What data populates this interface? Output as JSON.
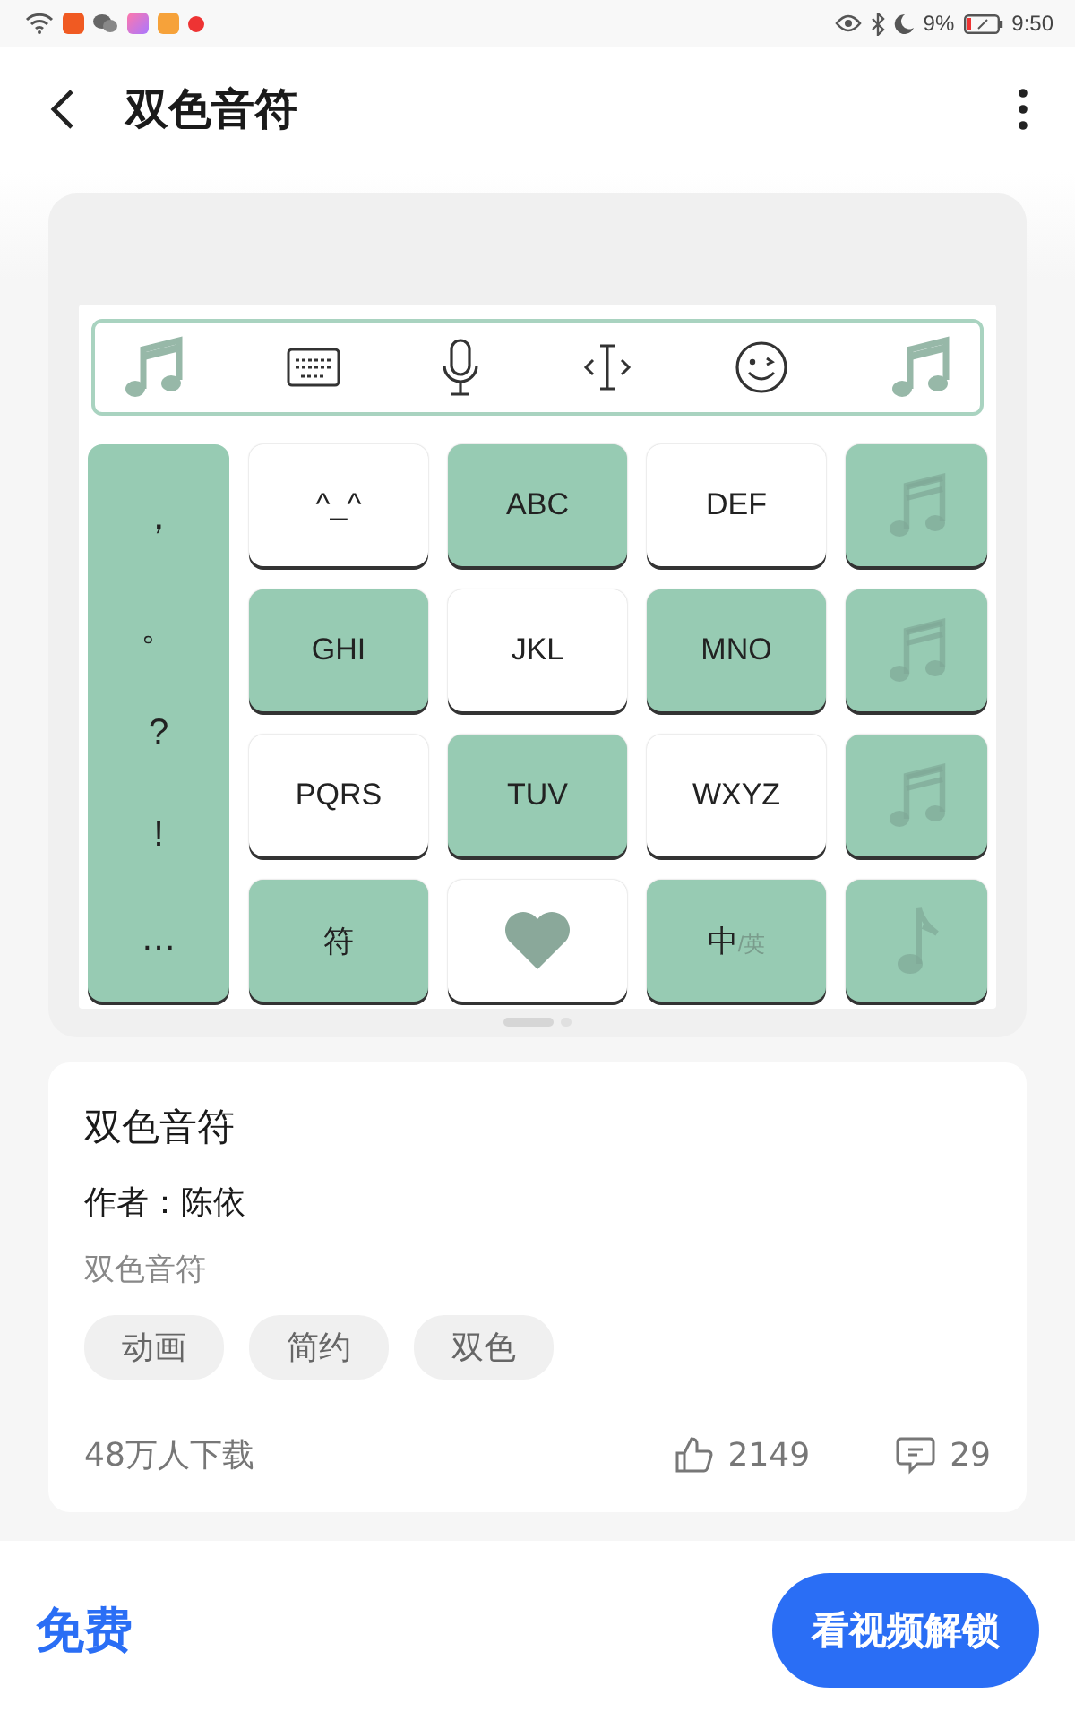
{
  "status_bar": {
    "battery": "9%",
    "time": "9:50"
  },
  "header": {
    "title": "双色音符"
  },
  "preview": {
    "toolbar": [
      {
        "kind": "note"
      },
      {
        "kind": "keyboard"
      },
      {
        "kind": "mic"
      },
      {
        "kind": "cursor"
      },
      {
        "kind": "emoji"
      },
      {
        "kind": "note"
      }
    ],
    "punctuation": [
      "，",
      "。",
      "?",
      "!",
      "…"
    ],
    "keys": [
      {
        "kind": "text",
        "label": "^_^",
        "color": "#ffffff"
      },
      {
        "kind": "text",
        "label": "ABC",
        "color": "#97cbb3"
      },
      {
        "kind": "text",
        "label": "DEF",
        "color": "#ffffff"
      },
      {
        "kind": "text",
        "label": "GHI",
        "color": "#97cbb3"
      },
      {
        "kind": "text",
        "label": "JKL",
        "color": "#ffffff"
      },
      {
        "kind": "text",
        "label": "MNO",
        "color": "#97cbb3"
      },
      {
        "kind": "text",
        "label": "PQRS",
        "color": "#ffffff"
      },
      {
        "kind": "text",
        "label": "TUV",
        "color": "#97cbb3"
      },
      {
        "kind": "text",
        "label": "WXYZ",
        "color": "#ffffff"
      },
      {
        "kind": "text",
        "label": "符",
        "color": "#97cbb3"
      },
      {
        "kind": "heart",
        "color": "#ffffff"
      },
      {
        "kind": "lang",
        "label": "中",
        "sub": "/英",
        "color": "#97cbb3"
      }
    ],
    "side_keys": [
      {
        "kind": "double-note"
      },
      {
        "kind": "double-note"
      },
      {
        "kind": "double-note"
      },
      {
        "kind": "note"
      }
    ],
    "pages": [
      {
        "selected": true
      },
      {
        "selected": false
      }
    ]
  },
  "info": {
    "name": "双色音符",
    "author": "作者：陈依",
    "description": "双色音符",
    "tags": [
      "动画",
      "简约",
      "双色"
    ],
    "downloads": "48万人下载",
    "likes": "2149",
    "comments": "29"
  },
  "footer": {
    "price": "免费",
    "action": "看视频解锁"
  }
}
